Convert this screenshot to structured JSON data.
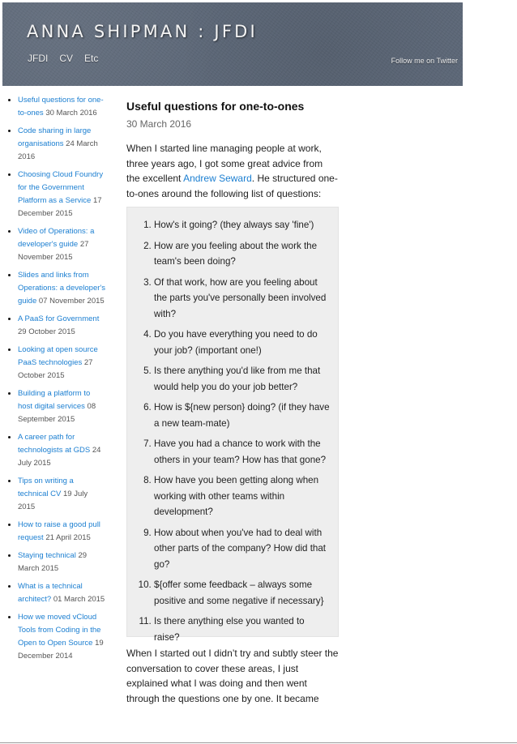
{
  "header": {
    "site_title": "ANNA SHIPMAN : JFDI",
    "nav": [
      {
        "label": "JFDI"
      },
      {
        "label": "CV"
      },
      {
        "label": "Etc"
      }
    ],
    "twitter_link": "Follow me on Twitter"
  },
  "sidebar": {
    "posts": [
      {
        "title": "Useful questions for one-to-ones",
        "date": "30 March 2016"
      },
      {
        "title": "Code sharing in large organisations",
        "date": "24 March 2016"
      },
      {
        "title": "Choosing Cloud Foundry for the Government Platform as a Service",
        "date": "17 December 2015"
      },
      {
        "title": "Video of Operations: a developer's guide",
        "date": "27 November 2015"
      },
      {
        "title": "Slides and links from Operations: a developer's guide",
        "date": "07 November 2015"
      },
      {
        "title": "A PaaS for Government",
        "date": "29 October 2015"
      },
      {
        "title": "Looking at open source PaaS technologies",
        "date": "27 October 2015"
      },
      {
        "title": "Building a platform to host digital services",
        "date": "08 September 2015"
      },
      {
        "title": "A career path for technologists at GDS",
        "date": "24 July 2015"
      },
      {
        "title": "Tips on writing a technical CV",
        "date": "19 July 2015"
      },
      {
        "title": "How to raise a good pull request",
        "date": "21 April 2015"
      },
      {
        "title": "Staying technical",
        "date": "29 March 2015"
      },
      {
        "title": "What is a technical architect?",
        "date": "01 March 2015"
      },
      {
        "title": "How we moved vCloud Tools from Coding in the Open to Open Source",
        "date": "19 December 2014"
      }
    ]
  },
  "post": {
    "title": "Useful questions for one-to-ones",
    "date": "30 March 2016",
    "intro_before_link": "When I started line managing people at work, three years ago, I got some great advice from the excellent ",
    "intro_link": "Andrew Seward",
    "intro_after_link": ". He structured one-to-ones around the following list of questions:",
    "questions": [
      "How's it going? (they always say 'fine')",
      "How are you feeling about the work the team's been doing?",
      "Of that work, how are you feeling about the parts you've personally been involved with?",
      "Do you have everything you need to do your job? (important one!)",
      "Is there anything you'd like from me that would help you do your job better?",
      "How is ${new person} doing? (if they have a new team-mate)",
      "Have you had a chance to work with the others in your team? How has that gone?",
      "How have you been getting along when working with other teams within development?",
      "How about when you've had to deal with other parts of the company? How did that go?",
      "${offer some feedback – always some positive and some negative if necessary}",
      "Is there anything else you wanted to raise?"
    ],
    "after_para": "When I started out I didn’t try and subtly steer the conversation to cover these areas, I just explained what I was doing and then went through the questions one by one. It became"
  },
  "colors": {
    "link": "#1c7fd1",
    "header_bg": "#5d6878",
    "box_bg": "#eeeeee"
  }
}
